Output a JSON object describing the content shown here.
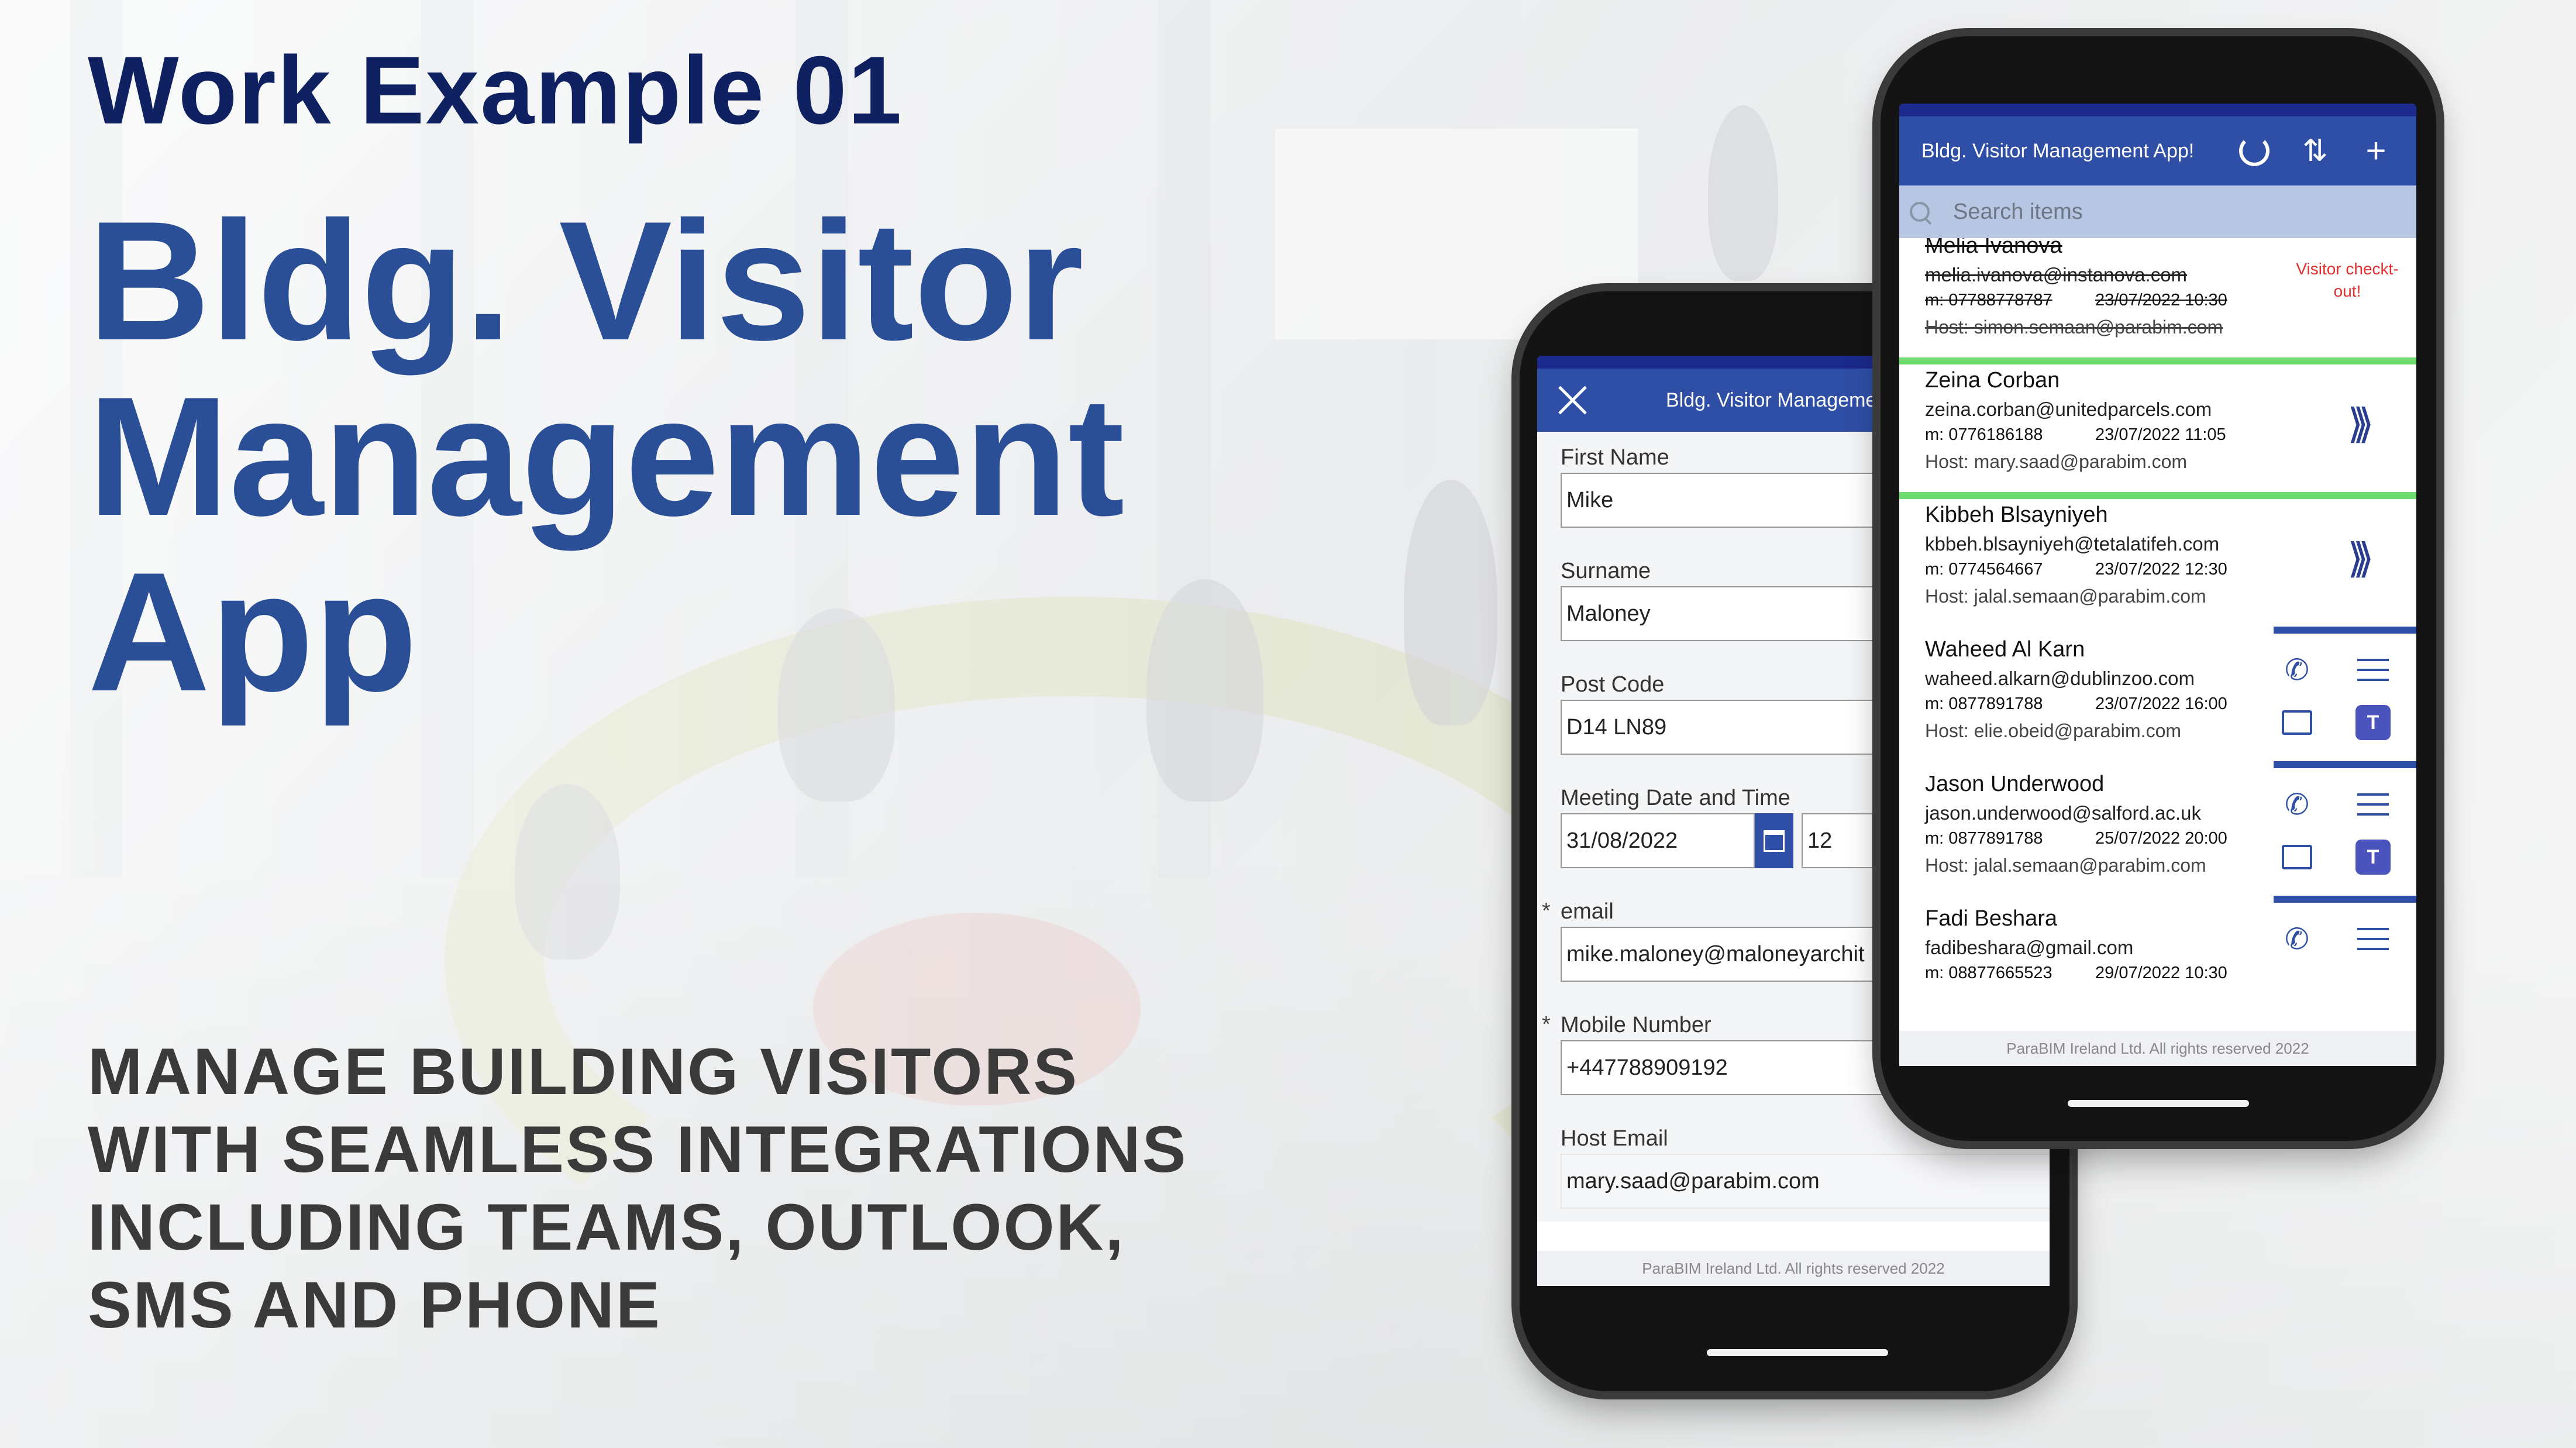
{
  "headline": {
    "kicker": "Work Example 01",
    "title_lines": [
      "Bldg. Visitor",
      "Management",
      "App"
    ],
    "tagline_lines": [
      "MANAGE BUILDING VISITORS",
      "WITH SEAMLESS INTEGRATIONS",
      "INCLUDING TEAMS, OUTLOOK,",
      "SMS AND PHONE"
    ]
  },
  "colors": {
    "accent": "#2f4fa6",
    "kicker": "#0f2160",
    "title": "#2b4f96",
    "status_checked_in": "#6fdc6f",
    "status_default": "#2f4fa6",
    "teams": "#4b53bc",
    "alert": "#e03030"
  },
  "form_screen": {
    "title": "Bldg. Visitor Management",
    "close_icon": "close-icon",
    "fields": {
      "first_name": {
        "label": "First Name",
        "value": "Mike"
      },
      "surname": {
        "label": "Surname",
        "value": "Maloney"
      },
      "post_code": {
        "label": "Post Code",
        "value": "D14 LN89"
      },
      "meeting": {
        "label": "Meeting Date and Time",
        "date": "31/08/2022",
        "hour": "12"
      },
      "email": {
        "label": "email",
        "value": "mike.maloney@maloneyarchit",
        "required": "*"
      },
      "mobile": {
        "label": "Mobile Number",
        "value": "+447788909192",
        "required": "*"
      },
      "host_email": {
        "label": "Host Email",
        "value": "mary.saad@parabim.com"
      }
    },
    "footer": "ParaBIM Ireland Ltd. All rights reserved 2022"
  },
  "list_screen": {
    "title": "Bldg. Visitor Management App!",
    "icons": [
      "refresh-icon",
      "sort-icon",
      "add-icon"
    ],
    "search_placeholder": "Search items",
    "items": [
      {
        "name": "Melia Ivanova",
        "email": "melia.ivanova@instanova.com",
        "mobile": "m: 07788778787",
        "datetime": "23/07/2022 10:30",
        "host": "Host: simon.semaan@parabim.com",
        "status": "checked-out",
        "badge": "Visitor checkt-out!"
      },
      {
        "name": "Zeina Corban",
        "email": "zeina.corban@unitedparcels.com",
        "mobile": "m: 0776186188",
        "datetime": "23/07/2022 11:05",
        "host": "Host: mary.saad@parabim.com",
        "status": "checked-in"
      },
      {
        "name": "Kibbeh Blsayniyeh",
        "email": "kbbeh.blsayniyeh@tetalatifeh.com",
        "mobile": "m: 0774564667",
        "datetime": "23/07/2022 12:30",
        "host": "Host: jalal.semaan@parabim.com",
        "status": "checked-in"
      },
      {
        "name": "Waheed Al Karn",
        "email": "waheed.alkarn@dublinzoo.com",
        "mobile": "m: 0877891788",
        "datetime": "23/07/2022 16:00",
        "host": "Host: elie.obeid@parabim.com",
        "status": "expected"
      },
      {
        "name": "Jason Underwood",
        "email": "jason.underwood@salford.ac.uk",
        "mobile": "m: 0877891788",
        "datetime": "25/07/2022 20:00",
        "host": "Host: jalal.semaan@parabim.com",
        "status": "expected"
      },
      {
        "name": "Fadi Beshara",
        "email": "fadibeshara@gmail.com",
        "mobile": "m: 08877665523",
        "datetime": "29/07/2022 10:30",
        "host": "",
        "status": "expected"
      }
    ],
    "footer": "ParaBIM Ireland Ltd. All rights reserved 2022"
  }
}
